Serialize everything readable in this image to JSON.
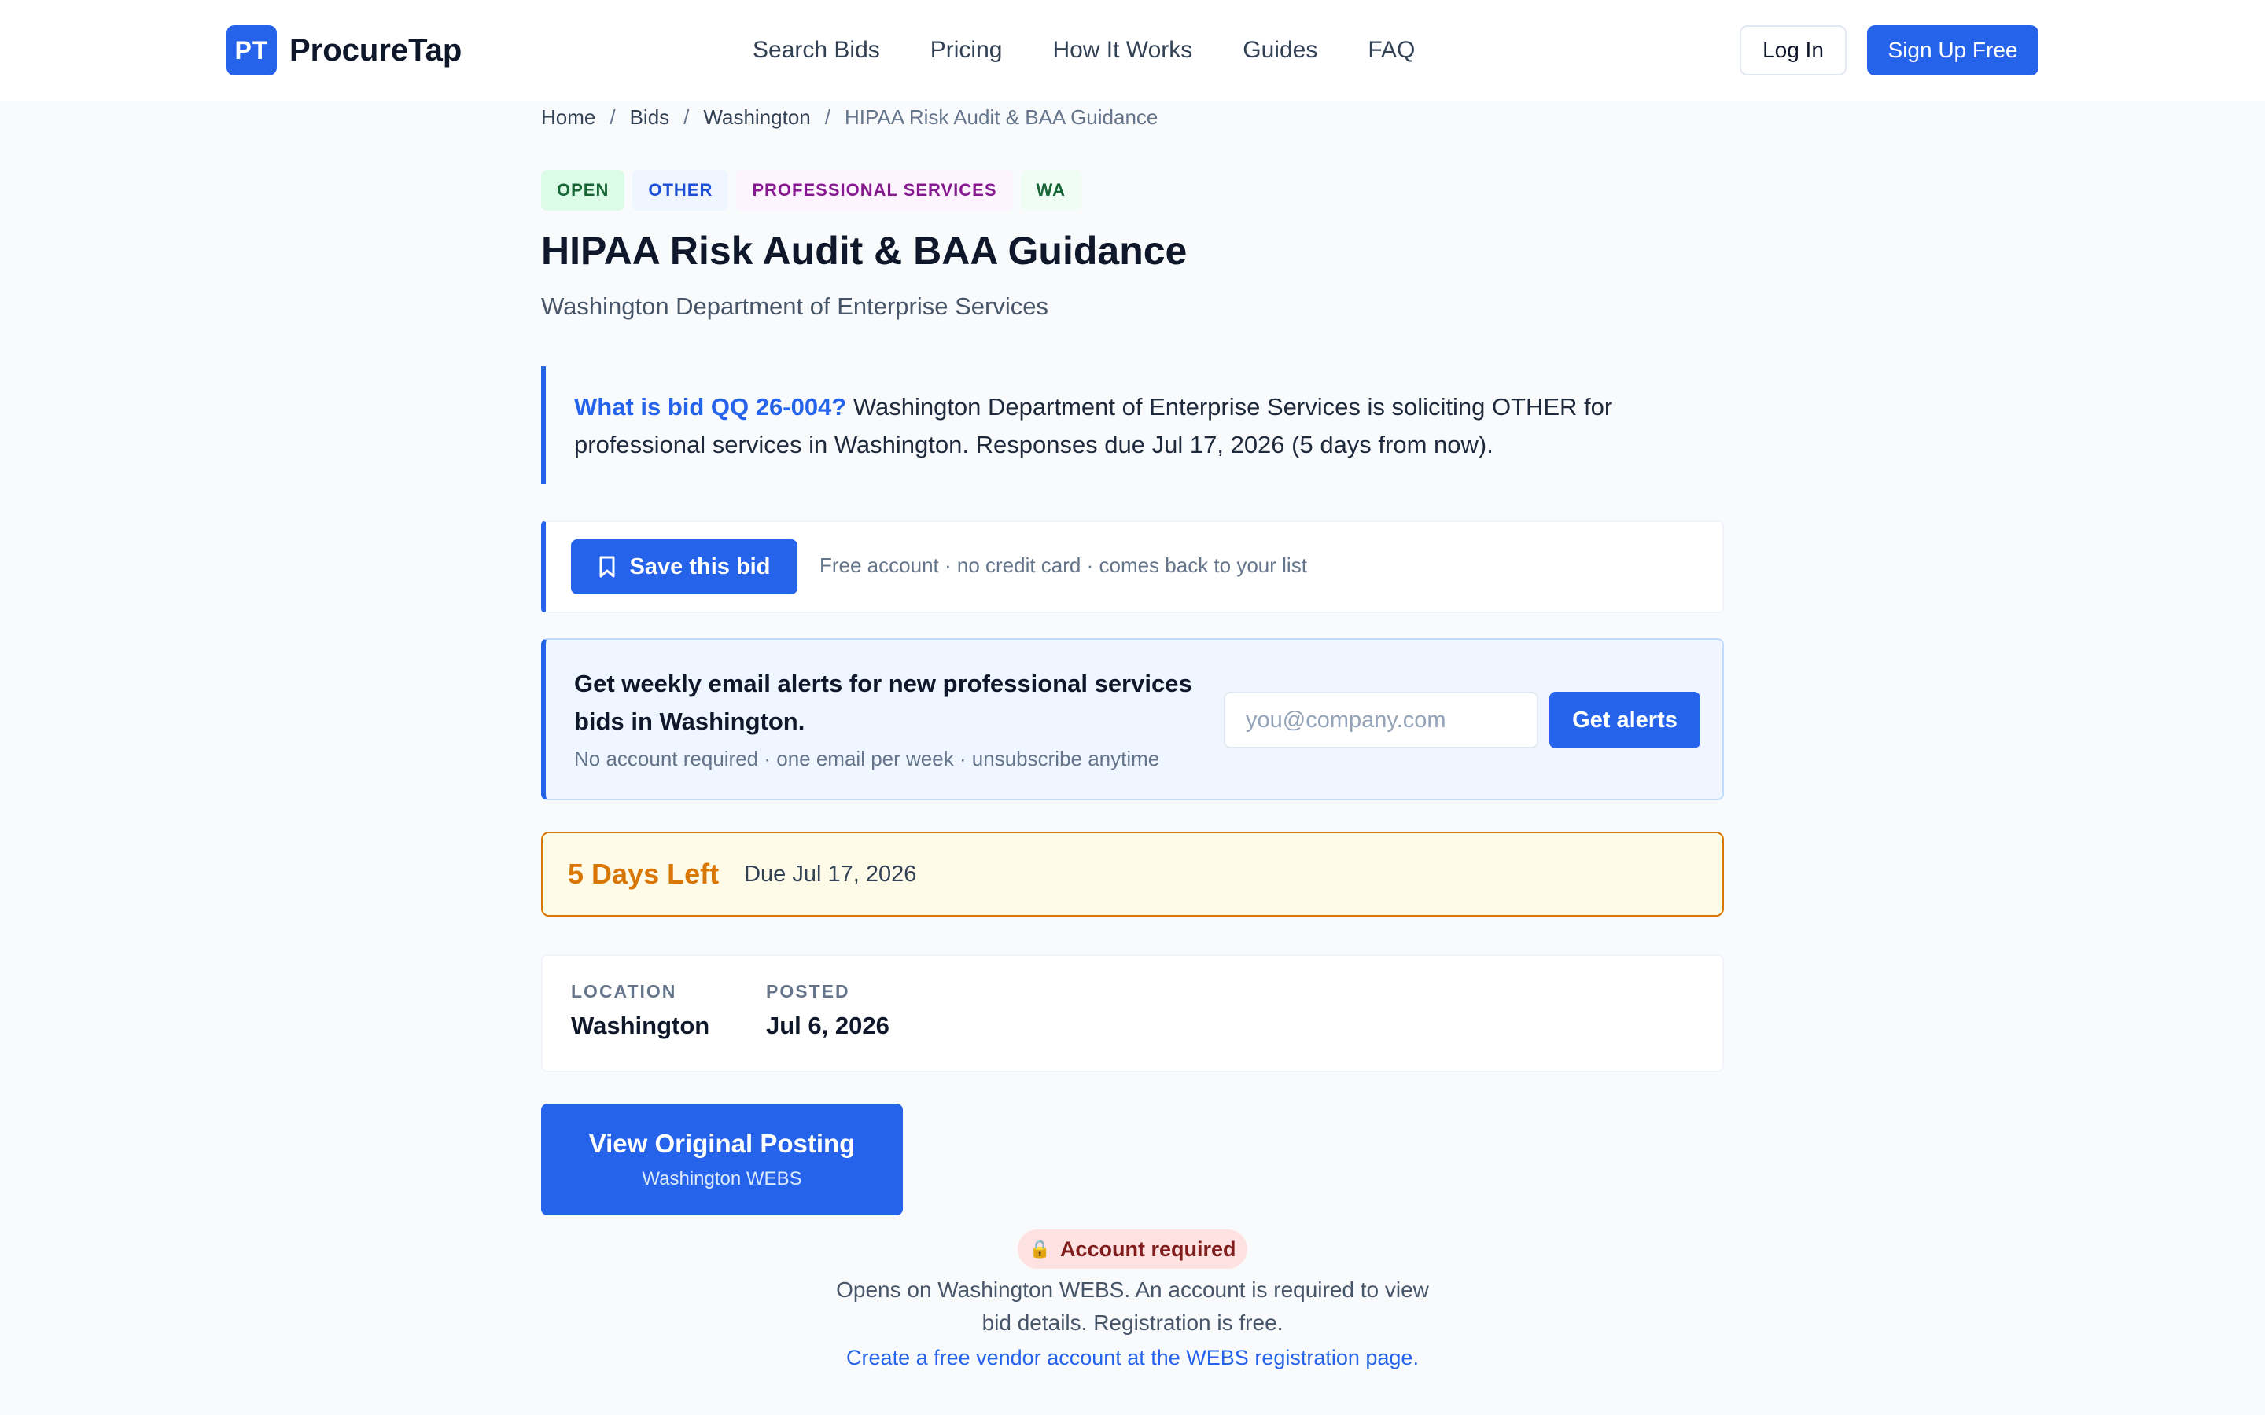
{
  "brand": {
    "mark": "PT",
    "name": "ProcureTap"
  },
  "nav": [
    "Search Bids",
    "Pricing",
    "How It Works",
    "Guides",
    "FAQ"
  ],
  "header": {
    "login": "Log In",
    "signup": "Sign Up Free"
  },
  "breadcrumb": [
    "Home",
    "Bids",
    "Washington",
    "HIPAA Risk Audit & BAA Guidance"
  ],
  "tags": [
    "OPEN",
    "OTHER",
    "PROFESSIONAL SERVICES",
    "WA"
  ],
  "bid": {
    "title": "HIPAA Risk Audit & BAA Guidance",
    "agency": "Washington Department of Enterprise Services"
  },
  "summary": {
    "question": "What is bid QQ 26-004?",
    "text": " Washington Department of Enterprise Services is soliciting OTHER for professional services in Washington. Responses due Jul 17, 2026 (5 days from now)."
  },
  "save": {
    "button": "Save this bid",
    "note": "Free account · no credit card · comes back to your list"
  },
  "alerts": {
    "title": "Get weekly email alerts for new professional services bids in Washington.",
    "note": "No account required · one email per week · unsubscribe anytime",
    "placeholder": "you@company.com",
    "button": "Get alerts"
  },
  "deadline": {
    "days_left": "5 Days Left",
    "due": "Due Jul 17, 2026"
  },
  "meta": {
    "location_label": "LOCATION",
    "location": "Washington",
    "posted_label": "POSTED",
    "posted": "Jul 6, 2026"
  },
  "original": {
    "button": "View Original Posting",
    "source": "Washington WEBS"
  },
  "account": {
    "badge": "Account required",
    "note": "Opens on Washington WEBS. An account is required to view bid details. Registration is free.",
    "link": "Create a free vendor account at the WEBS registration page."
  },
  "colors": {
    "accent": "#2563eb",
    "warning": "#d97706",
    "danger_bg": "#fee2e2"
  }
}
